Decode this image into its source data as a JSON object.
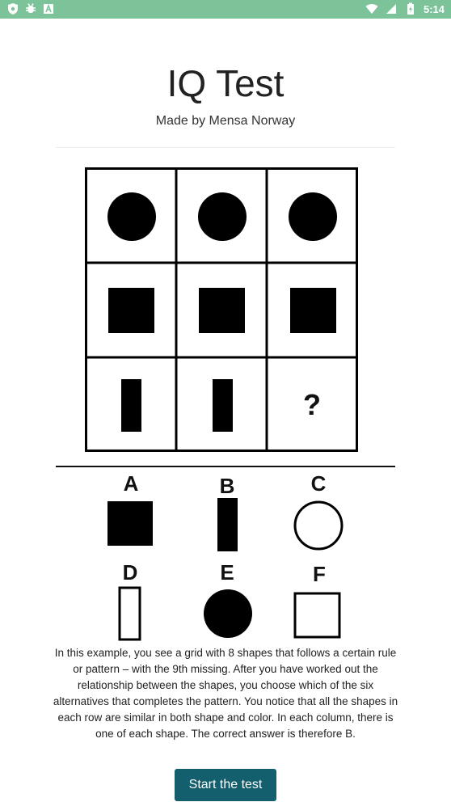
{
  "status_bar": {
    "time": "5:14",
    "bg_color": "#7cc39a",
    "left_icons": [
      "shield-icon",
      "bug-icon",
      "font-icon"
    ],
    "right_icons": [
      "wifi-icon",
      "signal-icon",
      "battery-charging-icon"
    ]
  },
  "header": {
    "title": "IQ Test",
    "subtitle": "Made by Mensa Norway"
  },
  "puzzle": {
    "grid_cells": [
      [
        "filled-circle",
        "filled-circle",
        "filled-circle"
      ],
      [
        "filled-square",
        "filled-square",
        "filled-square"
      ],
      [
        "filled-bar",
        "filled-bar",
        "?"
      ]
    ],
    "question_mark": "?"
  },
  "options": [
    {
      "letter": "A",
      "shape": "filled-square"
    },
    {
      "letter": "B",
      "shape": "filled-bar"
    },
    {
      "letter": "C",
      "shape": "outline-circle"
    },
    {
      "letter": "D",
      "shape": "outline-bar"
    },
    {
      "letter": "E",
      "shape": "filled-circle"
    },
    {
      "letter": "F",
      "shape": "outline-square"
    }
  ],
  "description": "In this example, you see a grid with 8 shapes that follows a certain rule or pattern – with the 9th missing. After you have worked out the relationship between the shapes, you choose which of the six alternatives that completes the pattern. You notice that all the shapes in each row are similar in both shape and color. In each column, there is one of each shape. The correct answer is therefore B.",
  "start_button": {
    "label": "Start the test",
    "color": "#145f6e"
  }
}
